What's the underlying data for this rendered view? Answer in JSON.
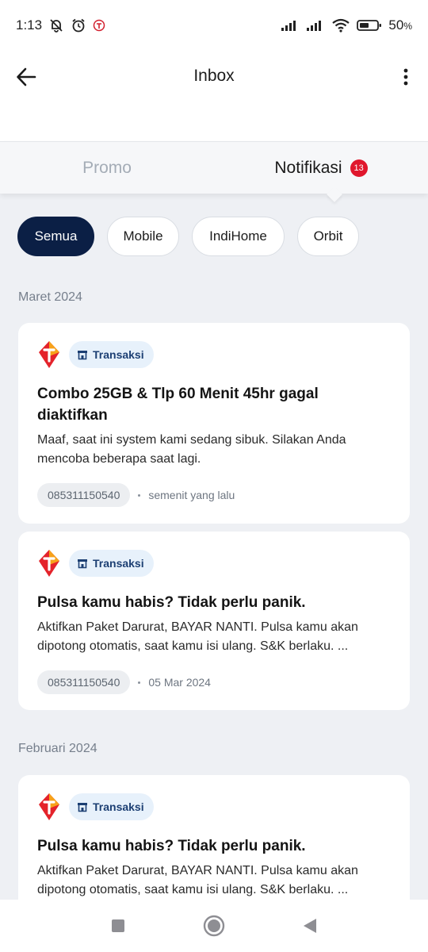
{
  "status_bar": {
    "time": "1:13",
    "battery": "50",
    "battery_unit": "%"
  },
  "header": {
    "title": "Inbox"
  },
  "tabs": [
    {
      "label": "Promo",
      "active": false
    },
    {
      "label": "Notifikasi",
      "active": true,
      "badge": "13"
    }
  ],
  "filters": [
    {
      "label": "Semua",
      "active": true
    },
    {
      "label": "Mobile",
      "active": false
    },
    {
      "label": "IndiHome",
      "active": false
    },
    {
      "label": "Orbit",
      "active": false
    }
  ],
  "sections": [
    {
      "label": "Maret 2024",
      "cards": [
        {
          "category": "Transaksi",
          "title": "Combo 25GB & Tlp 60 Menit 45hr gagal diaktifkan",
          "description": "Maaf, saat ini system kami sedang sibuk. Silakan Anda mencoba beberapa saat lagi.",
          "phone": "085311150540",
          "time": "semenit yang lalu"
        },
        {
          "category": "Transaksi",
          "title": "Pulsa kamu habis? Tidak perlu panik.",
          "description": "Aktifkan Paket Darurat, BAYAR NANTI. Pulsa kamu akan dipotong otomatis, saat kamu isi ulang. S&K berlaku. ...",
          "phone": "085311150540",
          "time": "05 Mar 2024"
        }
      ]
    },
    {
      "label": "Februari 2024",
      "cards": [
        {
          "category": "Transaksi",
          "title": "Pulsa kamu habis? Tidak perlu panik.",
          "description": "Aktifkan Paket Darurat, BAYAR NANTI. Pulsa kamu akan dipotong otomatis, saat kamu isi ulang. S&K berlaku. ..."
        }
      ]
    }
  ],
  "colors": {
    "accent_dark": "#0b1f45",
    "badge_red": "#e0172d",
    "tag_bg": "#e7f1fb",
    "tag_text": "#1c3f73"
  }
}
